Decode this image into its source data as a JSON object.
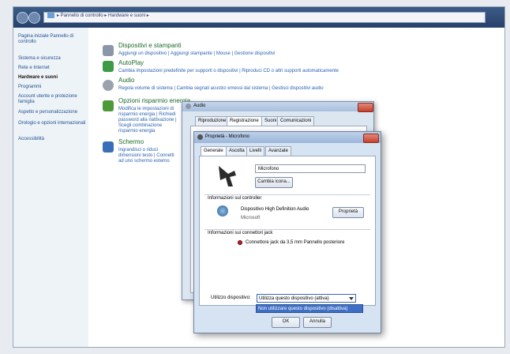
{
  "address": {
    "breadcrumb": "▸ Pannello di controllo ▸ Hardware e suoni ▸"
  },
  "sidebar": {
    "items": [
      {
        "label": "Pagina iniziale Pannello di controllo"
      },
      {
        "label": "Sistema e sicurezza"
      },
      {
        "label": "Rete e Internet"
      },
      {
        "label": "Hardware e suoni"
      },
      {
        "label": "Programmi"
      },
      {
        "label": "Account utente e protezione famiglia"
      },
      {
        "label": "Aspetto e personalizzazione"
      },
      {
        "label": "Orologio e opzioni internazionali"
      },
      {
        "label": "Accessibilità"
      }
    ]
  },
  "categories": [
    {
      "title": "Dispositivi e stampanti",
      "links": "Aggiungi un dispositivo | Aggiungi stampante | Mouse | Gestione dispositivi"
    },
    {
      "title": "AutoPlay",
      "links": "Cambia impostazioni predefinite per supporti o dispositivi | Riproduci CD o altri supporti automaticamente"
    },
    {
      "title": "Audio",
      "links": "Regola volume di sistema | Cambia segnali acustici emessi dal sistema | Gestisci dispositivi audio"
    },
    {
      "title": "Opzioni risparmio energia",
      "links": "Modifica le impostazioni di risparmio energia | Richiedi password alla riattivazione | Scegli combinazione risparmio energia"
    },
    {
      "title": "Schermo",
      "links": "Ingrandisci o riduci dimensioni testo | Connetti ad uno schermo esterno"
    }
  ],
  "audio_dialog": {
    "title": "Audio",
    "tabs": [
      "Riproduzione",
      "Registrazione",
      "Suoni",
      "Comunicazioni"
    ]
  },
  "props_dialog": {
    "title": "Proprietà - Microfono",
    "tabs": [
      "Generale",
      "Ascolta",
      "Livelli",
      "Avanzate"
    ],
    "device_name": "Microfono",
    "change_icon_label": "Cambia icona...",
    "controller_heading": "Informazioni sul controller",
    "controller_name": "Dispositivo High Definition Audio",
    "controller_vendor": "Microsoft",
    "properties_label": "Proprietà",
    "jack_heading": "Informazioni sui connettori jack",
    "jack_value": "Connettore jack da 3,5 mm Pannello posteriore",
    "usage_label": "Utilizzo dispositivo:",
    "usage_selected": "Utilizza questo dispositivo (attiva)",
    "usage_option_other": "Non utilizzare questo dispositivo (disattiva)",
    "ok_label": "OK",
    "cancel_label": "Annulla"
  }
}
